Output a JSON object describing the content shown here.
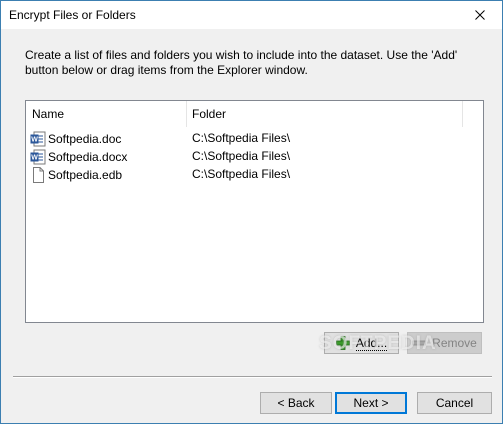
{
  "window": {
    "title": "Encrypt Files or Folders",
    "close_icon": "close-icon"
  },
  "instructions": "Create a list of files and folders you wish to include into the dataset. Use the 'Add' button below or drag items from the Explorer window.",
  "list": {
    "columns": [
      "Name",
      "Folder"
    ],
    "rows": [
      {
        "name": "Softpedia.doc",
        "folder": "C:\\Softpedia Files\\",
        "icon": "word-document-icon"
      },
      {
        "name": "Softpedia.docx",
        "folder": "C:\\Softpedia Files\\",
        "icon": "word-document-icon"
      },
      {
        "name": "Softpedia.edb",
        "folder": "C:\\Softpedia Files\\",
        "icon": "blank-file-icon"
      }
    ]
  },
  "buttons": {
    "add": "Add...",
    "remove": "Remove",
    "back": "< Back",
    "next": "Next >",
    "cancel": "Cancel"
  },
  "watermark": "SOFTPEDIA",
  "colors": {
    "accent": "#0078d7",
    "word_blue": "#2b579a",
    "add_green": "#3a9a2a"
  }
}
